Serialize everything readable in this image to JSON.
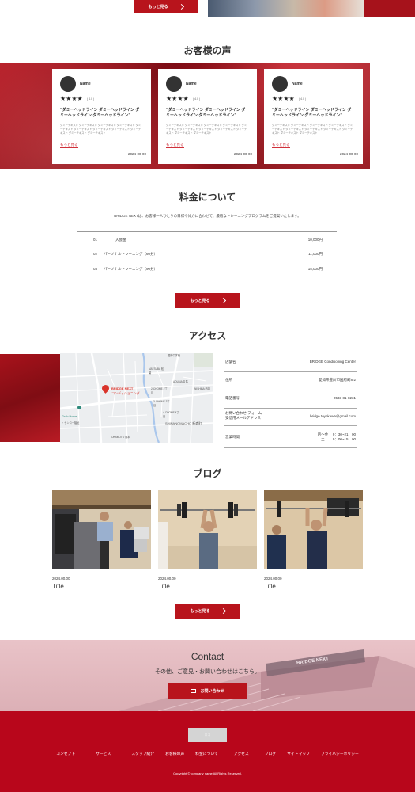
{
  "top": {
    "more_label": "もっと見る"
  },
  "voice": {
    "title": "お客様の声",
    "cards": [
      {
        "name": "Name",
        "stars": "★★★★",
        "rating": "( 4.0 )",
        "headline": "“ダミーヘッドライン ダミーヘッドライン ダミーヘッドライン ダミーヘッドライン”",
        "body": "ダミーテキスト ダミーテキスト ダミーテキスト ダミーテキスト ダミーテキスト ダミーテキスト ダミーテキスト ダミーテキスト ダミーテキスト ダミーテキスト ダミーテキスト",
        "more": "もっと見る",
        "date": "2024-00-00"
      },
      {
        "name": "Name",
        "stars": "★★★★",
        "rating": "( 4.0 )",
        "headline": "“ダミーヘッドライン ダミーヘッドライン ダミーヘッドライン ダミーヘッドライン”",
        "body": "ダミーテキスト ダミーテキスト ダミーテキスト ダミーテキスト ダミーテキスト ダミーテキスト ダミーテキスト ダミーテキスト ダミーテキスト ダミーテキスト ダミーテキスト",
        "more": "もっと見る",
        "date": "2024-00-00"
      },
      {
        "name": "Name",
        "stars": "★★★★",
        "rating": "( 4.0 )",
        "headline": "“ダミーヘッドライン ダミーヘッドライン ダミーヘッドライン ダミーヘッドライン”",
        "body": "ダミーテキスト ダミーテキスト ダミーテキスト ダミーテキスト ダミーテキスト ダミーテキスト ダミーテキスト ダミーテキスト ダミーテキスト ダミーテキスト ダミーテキスト",
        "more": "もっと見る",
        "date": "2024-00-00"
      }
    ]
  },
  "pricing": {
    "title": "料金について",
    "description": "BRIDGE NEXTは、お客様一人ひとりの目標や体力に合わせて、最適なトレーニングプログラムをご提案いたします。",
    "rows": [
      {
        "num": "01",
        "label": "入会金",
        "price": "10,000円"
      },
      {
        "num": "02",
        "label": "パーソナルトレーニング（60分）",
        "price": "11,000円"
      },
      {
        "num": "03",
        "label": "パーソナルトレーニング（90分）",
        "price": "15,000円"
      }
    ],
    "more_label": "もっと見る"
  },
  "access": {
    "title": "アクセス",
    "map": {
      "pin_label_1": "BRIDGE NEXT",
      "pin_label_2": "コンディショニング",
      "labels": [
        "国府中学校",
        "MATSUBA 松葉",
        "AOUMA 青馬",
        "NISHIBA 西場",
        "2-CHOME 2丁目",
        "3-CHOME 3丁目",
        "4-CHOME 4丁目",
        "SHINANOMACHO 新森町",
        "OKAMOTO 岡本",
        "Grab Home",
        "・サンコー福祉"
      ]
    },
    "rows": [
      {
        "key": "店舗名",
        "value": "BRIDGE Conditioning Center"
      },
      {
        "key": "住所",
        "value": "愛知県豊川市国府町8-2"
      },
      {
        "key": "電話番号",
        "value": "0533-81-8231"
      },
      {
        "key": "お問い合わせ フォーム\n受信用メールアドレス",
        "value": "bridge.toyokawa@gmail.com"
      },
      {
        "key": "営業時間",
        "value": "月～金　 9：30~21：00\n土　　 9：00~15：00"
      }
    ]
  },
  "blog": {
    "title": "ブログ",
    "posts": [
      {
        "date": "2024.00.00",
        "title": "Title"
      },
      {
        "date": "2024.00.00",
        "title": "Title"
      },
      {
        "date": "2024.00.00",
        "title": "Title"
      }
    ],
    "more_label": "もっと見る"
  },
  "contact": {
    "title": "Contact",
    "subtitle": "その他、ご意見・お問い合わせはこちら。",
    "button_label": "お問い合わせ",
    "building_sign": "BRIDGE NEXT"
  },
  "footer": {
    "logo_text": "ロゴ",
    "nav": [
      "コンセプト",
      "サービス",
      "スタッフ紹介",
      "お客様の声",
      "料金について",
      "アクセス",
      "ブログ",
      "サイトマップ",
      "プライバシーポリシー"
    ],
    "copyright": "Copyright © company name All Rights Reserved."
  },
  "colors": {
    "brand_red": "#b8141c",
    "footer_red": "#b8061b",
    "contact_pink": "#e9c3c8"
  }
}
